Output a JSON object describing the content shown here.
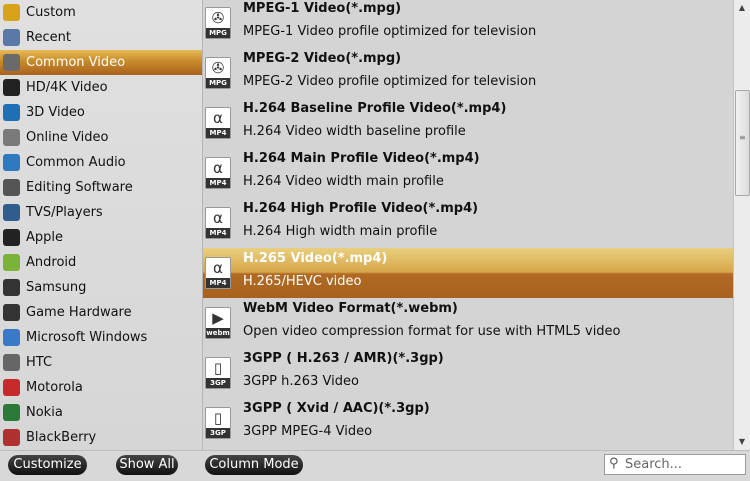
{
  "categories": [
    {
      "label": "Custom",
      "icon": "folder-icon",
      "color": "#d8a31a"
    },
    {
      "label": "Recent",
      "icon": "recent-icon",
      "color": "#5a79a8"
    },
    {
      "label": "Common Video",
      "icon": "film-icon",
      "color": "#6a6a6a",
      "selected": true
    },
    {
      "label": "HD/4K Video",
      "icon": "hd-icon",
      "color": "#222222"
    },
    {
      "label": "3D Video",
      "icon": "3d-icon",
      "color": "#1f6fb5"
    },
    {
      "label": "Online Video",
      "icon": "globe-icon",
      "color": "#7a7a7a"
    },
    {
      "label": "Common Audio",
      "icon": "music-note-icon",
      "color": "#2e79c0"
    },
    {
      "label": "Editing Software",
      "icon": "clapperboard-icon",
      "color": "#555555"
    },
    {
      "label": "TVS/Players",
      "icon": "tv-icon",
      "color": "#2f5e8e"
    },
    {
      "label": "Apple",
      "icon": "phone-icon",
      "color": "#222222"
    },
    {
      "label": "Android",
      "icon": "android-icon",
      "color": "#7bb33a"
    },
    {
      "label": "Samsung",
      "icon": "samsung-phone-icon",
      "color": "#333333"
    },
    {
      "label": "Game Hardware",
      "icon": "gamepad-icon",
      "color": "#333333"
    },
    {
      "label": "Microsoft Windows",
      "icon": "windows-icon",
      "color": "#3a78c8"
    },
    {
      "label": "HTC",
      "icon": "htc-icon",
      "color": "#666666"
    },
    {
      "label": "Motorola",
      "icon": "motorola-icon",
      "color": "#c72a2a"
    },
    {
      "label": "Nokia",
      "icon": "nokia-icon",
      "color": "#2c7a3a"
    },
    {
      "label": "BlackBerry",
      "icon": "blackberry-icon",
      "color": "#b03030"
    }
  ],
  "formats": [
    {
      "title": "MPEG-1 Video(*.mpg)",
      "desc": "MPEG-1 Video profile optimized for television",
      "icon": "mpg-reel-icon",
      "glyph": "✇",
      "tag": "MPG"
    },
    {
      "title": "MPEG-2 Video(*.mpg)",
      "desc": "MPEG-2 Video profile optimized for television",
      "icon": "mpg-reel-icon",
      "glyph": "✇",
      "tag": "MPG"
    },
    {
      "title": "H.264 Baseline Profile Video(*.mp4)",
      "desc": "H.264 Video width baseline profile",
      "icon": "mp4-icon",
      "glyph": "α",
      "tag": "MP4"
    },
    {
      "title": "H.264 Main Profile Video(*.mp4)",
      "desc": "H.264 Video width main profile",
      "icon": "mp4-icon",
      "glyph": "α",
      "tag": "MP4"
    },
    {
      "title": "H.264 High Profile Video(*.mp4)",
      "desc": "H.264 High width main profile",
      "icon": "mp4-icon",
      "glyph": "α",
      "tag": "MP4"
    },
    {
      "title": "H.265 Video(*.mp4)",
      "desc": "H.265/HEVC video",
      "icon": "mp4-icon",
      "glyph": "α",
      "tag": "MP4",
      "selected": true
    },
    {
      "title": "WebM Video Format(*.webm)",
      "desc": "Open video compression format for use with HTML5 video",
      "icon": "webm-play-icon",
      "glyph": "▶",
      "tag": "webm"
    },
    {
      "title": "3GPP ( H.263 / AMR)(*.3gp)",
      "desc": "3GPP h.263 Video",
      "icon": "3gp-phone-icon",
      "glyph": "▯",
      "tag": "3GP"
    },
    {
      "title": "3GPP ( Xvid / AAC)(*.3gp)",
      "desc": "3GPP MPEG-4 Video",
      "icon": "3gp-phone-icon",
      "glyph": "▯",
      "tag": "3GP"
    }
  ],
  "scrollbar": {
    "up": "▲",
    "down": "▼",
    "grip": "≡"
  },
  "toolbar": {
    "customize": "Customize",
    "show_all": "Show All",
    "column_mode": "Column Mode"
  },
  "search": {
    "placeholder": "Search...",
    "icon": "search-icon",
    "glyph": "⚲"
  }
}
